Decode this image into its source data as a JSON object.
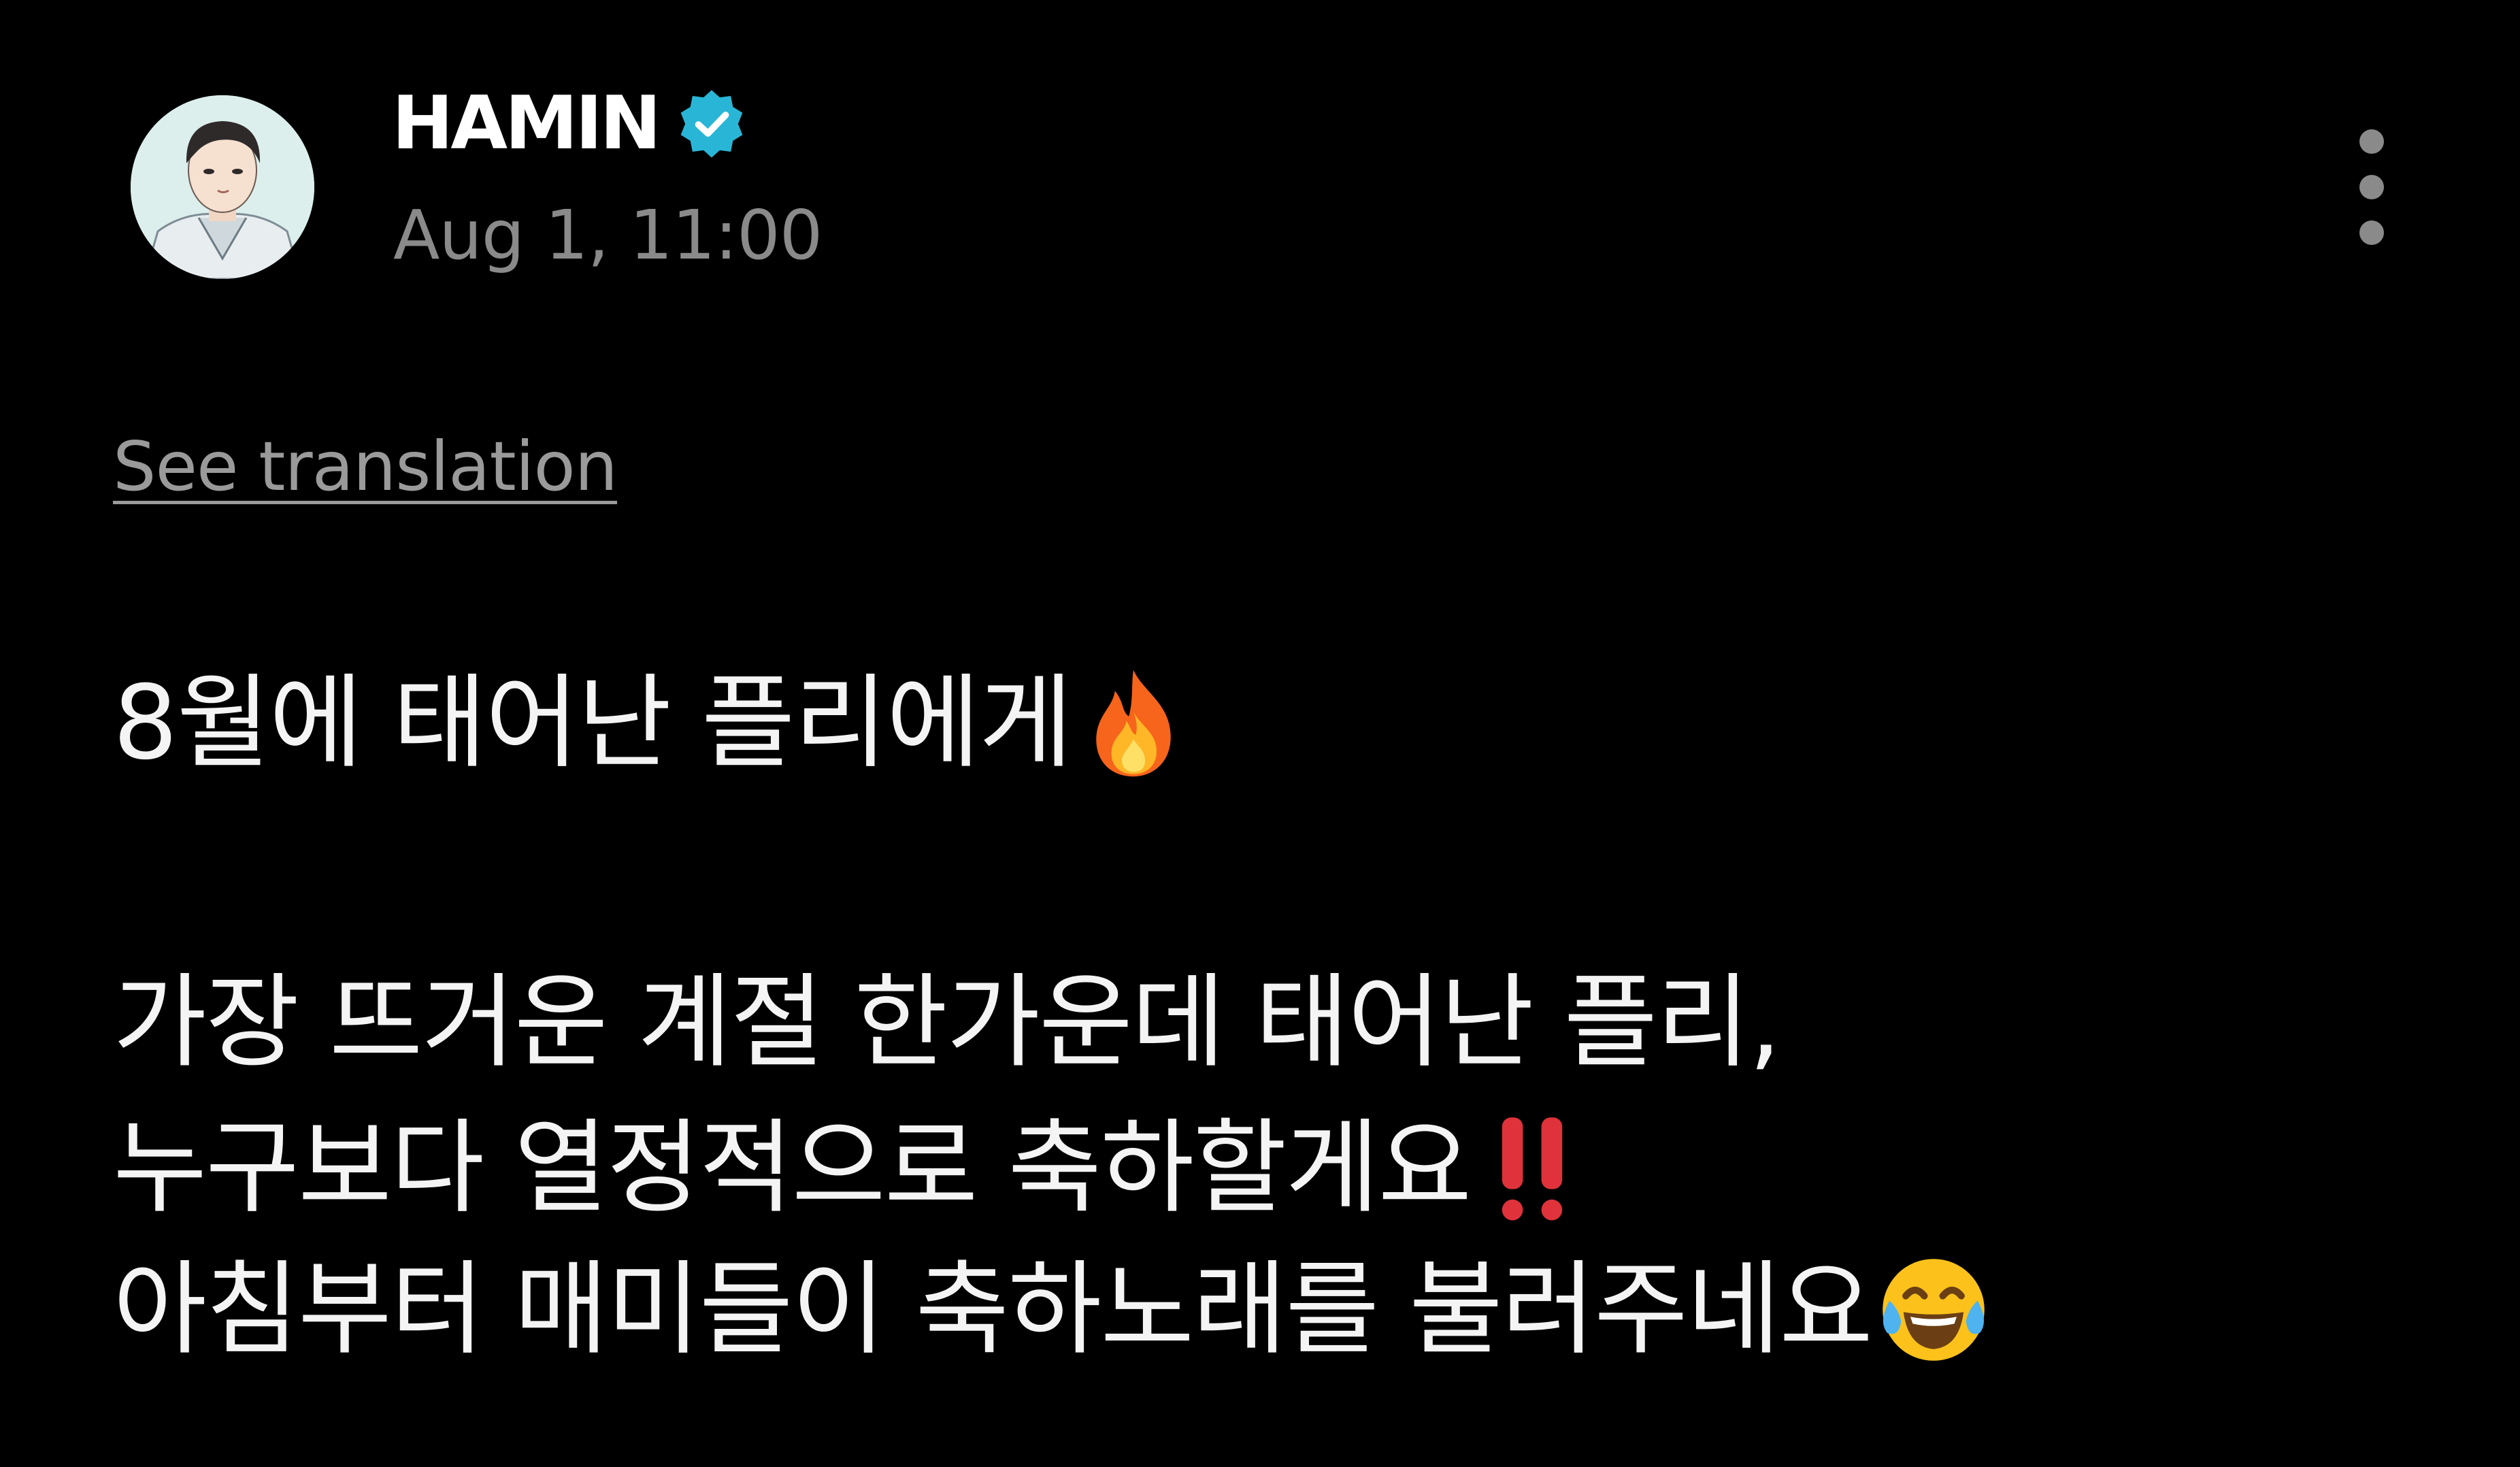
{
  "post": {
    "author": {
      "name": "HAMIN",
      "verified": true,
      "avatar_icon": "avatar-illustration"
    },
    "timestamp": "Aug 1, 11:00",
    "more_icon": "vertical-ellipsis-icon",
    "see_translation_label": "See translation",
    "lines": [
      {
        "text": "8월에 태어난 플리에게",
        "emoji": "fire-emoji"
      },
      {
        "text": "가장 뜨거운 계절 한가운데 태어난 플리,",
        "emoji": ""
      },
      {
        "text": "누구보다 열정적으로 축하할게요",
        "emoji": "double-exclamation-emoji"
      },
      {
        "text": "아침부터 매미들이 축하노래를 불러주네요",
        "emoji": "tears-of-joy-emoji"
      }
    ]
  },
  "colors": {
    "background": "#000000",
    "text": "#f4f4f4",
    "muted": "#8a8a8a",
    "verified_badge": "#29b6d6"
  }
}
